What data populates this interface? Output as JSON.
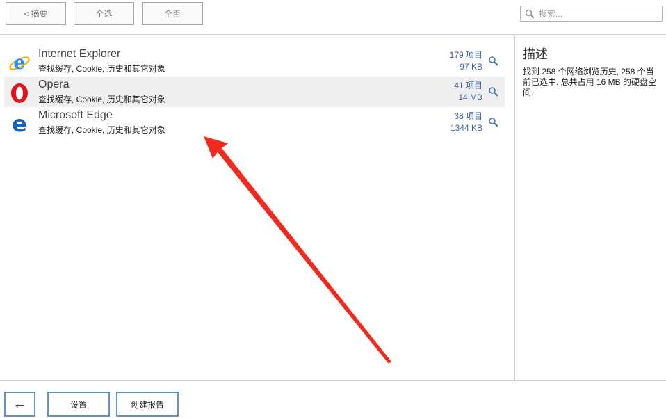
{
  "toolbar": {
    "back_label": "< 摘要",
    "select_all_label": "全选",
    "select_none_label": "全否",
    "search_placeholder": "搜索..."
  },
  "browsers": [
    {
      "name": "Internet Explorer",
      "description": "查找缓存, Cookie, 历史和其它对象",
      "count": "179 项目",
      "size": "97 KB",
      "icon": "internet-explorer-icon"
    },
    {
      "name": "Opera",
      "description": "查找缓存, Cookie, 历史和其它对象",
      "count": "41 项目",
      "size": "14 MB",
      "icon": "opera-icon"
    },
    {
      "name": "Microsoft Edge",
      "description": "查找缓存, Cookie, 历史和其它对象",
      "count": "38 项目",
      "size": "1344 KB",
      "icon": "edge-icon"
    }
  ],
  "panel": {
    "title": "描述",
    "text": "找到 258 个网络浏览历史, 258 个当前已选中. 总共占用 16 MB 的硬盘空间."
  },
  "bottom": {
    "back_label": "←",
    "settings_label": "设置",
    "report_label": "创建报告"
  },
  "colors": {
    "accent_border": "#5e95c8",
    "link_blue": "#3f5ea8",
    "annotation_red": "#f02a1e"
  }
}
